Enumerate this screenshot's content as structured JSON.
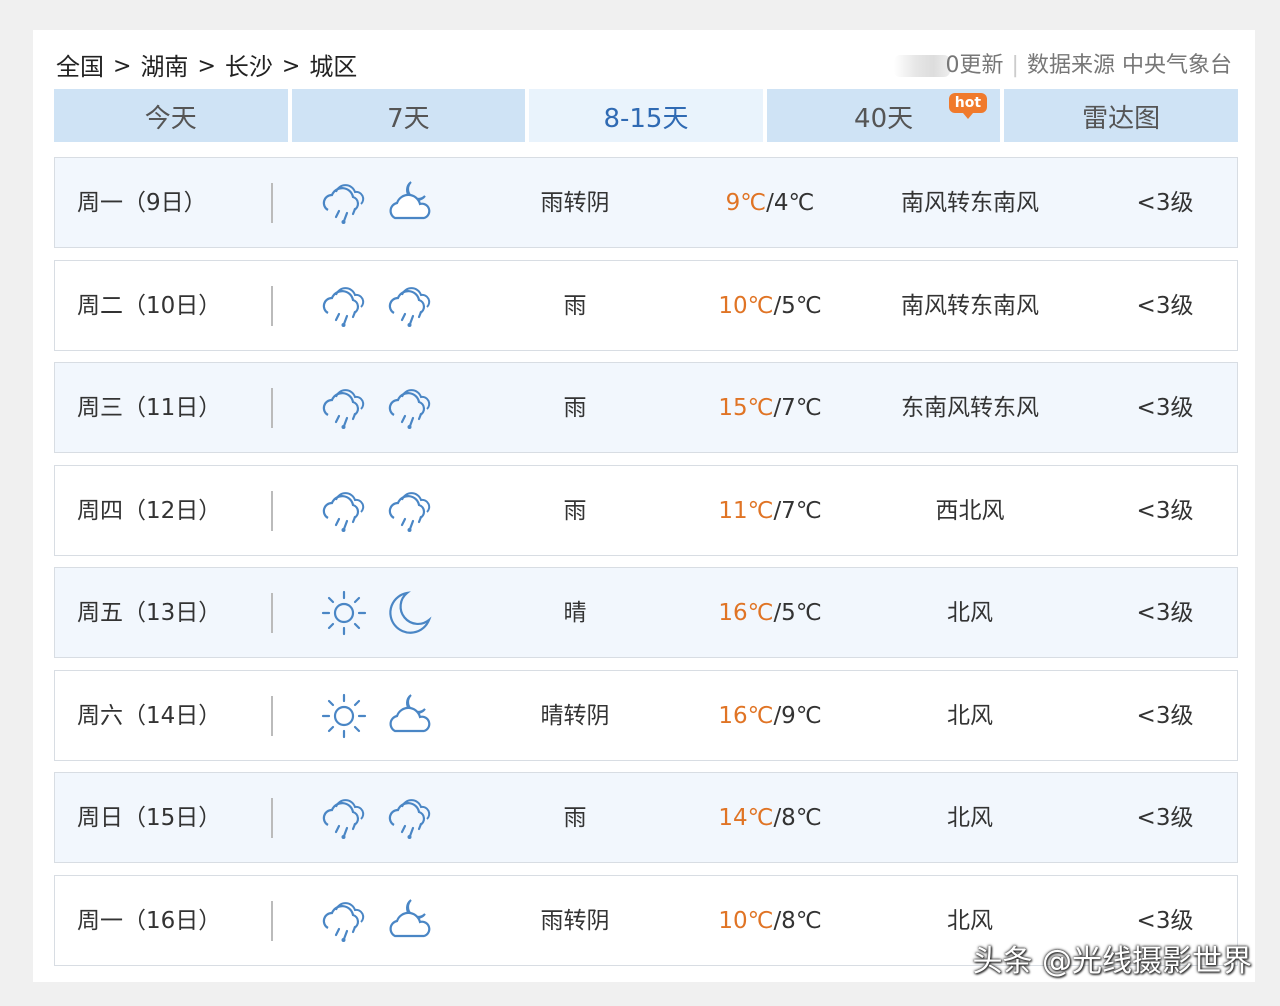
{
  "breadcrumb": [
    "全国",
    "湖南",
    "长沙",
    "城区"
  ],
  "breadcrumb_sep": ">",
  "meta": {
    "update_text": "0更新",
    "source_label": "数据来源",
    "source_name": "中央气象台"
  },
  "tabs": [
    {
      "label": "今天"
    },
    {
      "label": "7天"
    },
    {
      "label": "8-15天",
      "active": true
    },
    {
      "label": "40天",
      "badge": "hot"
    },
    {
      "label": "雷达图"
    }
  ],
  "forecast": [
    {
      "date": "周一（9日）",
      "day_icon": "rain-cloud-icon",
      "night_icon": "partly-cloudy-night-icon",
      "condition": "雨转阴",
      "high": "9℃",
      "low": "/4℃",
      "wind": "南风转东南风",
      "level": "<3级"
    },
    {
      "date": "周二（10日）",
      "day_icon": "rain-cloud-icon",
      "night_icon": "rain-cloud-icon",
      "condition": "雨",
      "high": "10℃",
      "low": "/5℃",
      "wind": "南风转东南风",
      "level": "<3级"
    },
    {
      "date": "周三（11日）",
      "day_icon": "rain-cloud-icon",
      "night_icon": "rain-cloud-icon",
      "condition": "雨",
      "high": "15℃",
      "low": "/7℃",
      "wind": "东南风转东风",
      "level": "<3级"
    },
    {
      "date": "周四（12日）",
      "day_icon": "rain-cloud-icon",
      "night_icon": "rain-cloud-icon",
      "condition": "雨",
      "high": "11℃",
      "low": "/7℃",
      "wind": "西北风",
      "level": "<3级"
    },
    {
      "date": "周五（13日）",
      "day_icon": "sun-icon",
      "night_icon": "moon-icon",
      "condition": "晴",
      "high": "16℃",
      "low": "/5℃",
      "wind": "北风",
      "level": "<3级"
    },
    {
      "date": "周六（14日）",
      "day_icon": "sun-icon",
      "night_icon": "partly-cloudy-night-icon",
      "condition": "晴转阴",
      "high": "16℃",
      "low": "/9℃",
      "wind": "北风",
      "level": "<3级"
    },
    {
      "date": "周日（15日）",
      "day_icon": "rain-cloud-icon",
      "night_icon": "rain-cloud-icon",
      "condition": "雨",
      "high": "14℃",
      "low": "/8℃",
      "wind": "北风",
      "level": "<3级"
    },
    {
      "date": "周一（16日）",
      "day_icon": "rain-cloud-icon",
      "night_icon": "partly-cloudy-night-icon",
      "condition": "雨转阴",
      "high": "10℃",
      "low": "/8℃",
      "wind": "北风",
      "level": "<3级"
    }
  ],
  "colors": {
    "tab_bg": "#cfe3f5",
    "tab_active_bg": "#e9f3fc",
    "tab_active_text": "#2f6ab3",
    "high_temp": "#e07425",
    "hot_badge": "#f07a2c",
    "icon_stroke": "#4a86c5"
  },
  "watermark": "头条 @光线摄影世界"
}
